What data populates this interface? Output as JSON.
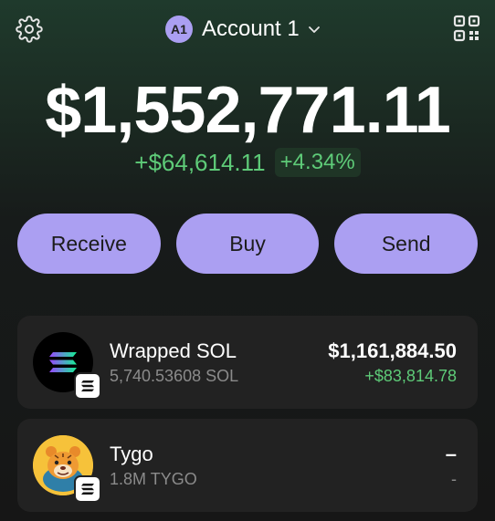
{
  "header": {
    "settings_icon": "gear-icon",
    "account_badge": "A1",
    "account_name": "Account 1",
    "account_chevron_icon": "chevron-down-icon",
    "qr_icon": "qr-code-icon"
  },
  "portfolio": {
    "balance": "$1,552,771.11",
    "change_usd": "+$64,614.11",
    "change_pct": "+4.34%"
  },
  "actions": {
    "receive_label": "Receive",
    "buy_label": "Buy",
    "send_label": "Send"
  },
  "tokens": [
    {
      "name": "Wrapped SOL",
      "amount": "5,740.53608 SOL",
      "value": "$1,161,884.50",
      "change": "+$83,814.78",
      "logo_icon": "solana-logo-icon",
      "chain_icon": "solana-chain-icon"
    },
    {
      "name": "Tygo",
      "amount": "1.8M TYGO",
      "value": "–",
      "change": "-",
      "logo_icon": "tygo-tiger-logo-icon",
      "chain_icon": "solana-chain-icon"
    }
  ],
  "colors": {
    "accent": "#ab9ff2",
    "positive": "#5ecb78",
    "card": "#222222"
  }
}
